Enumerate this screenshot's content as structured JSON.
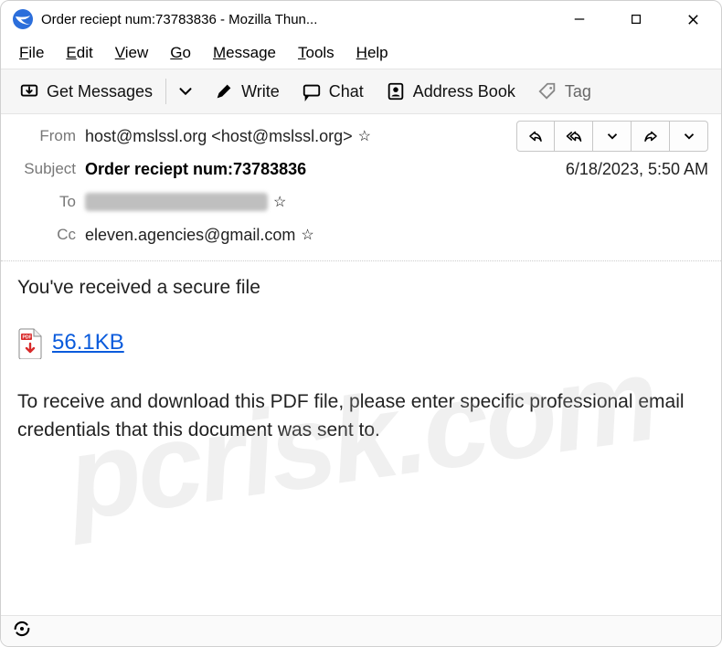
{
  "window": {
    "title": "Order reciept num:73783836 - Mozilla Thun..."
  },
  "menubar": [
    "File",
    "Edit",
    "View",
    "Go",
    "Message",
    "Tools",
    "Help"
  ],
  "toolbar": {
    "get_messages": "Get Messages",
    "write": "Write",
    "chat": "Chat",
    "address_book": "Address Book",
    "tag": "Tag"
  },
  "envelope": {
    "labels": {
      "from": "From",
      "subject": "Subject",
      "to": "To",
      "cc": "Cc"
    },
    "from": "host@mslssl.org <host@mslssl.org>",
    "subject": "Order reciept num:73783836",
    "cc": "eleven.agencies@gmail.com",
    "date": "6/18/2023, 5:50 AM"
  },
  "body": {
    "line1": "You've received a secure file",
    "attachment_size": "56.1KB",
    "para": "To receive and download this PDF file, please enter specific professional email credentials that this document was sent to."
  },
  "watermark": "pcrisk.com"
}
